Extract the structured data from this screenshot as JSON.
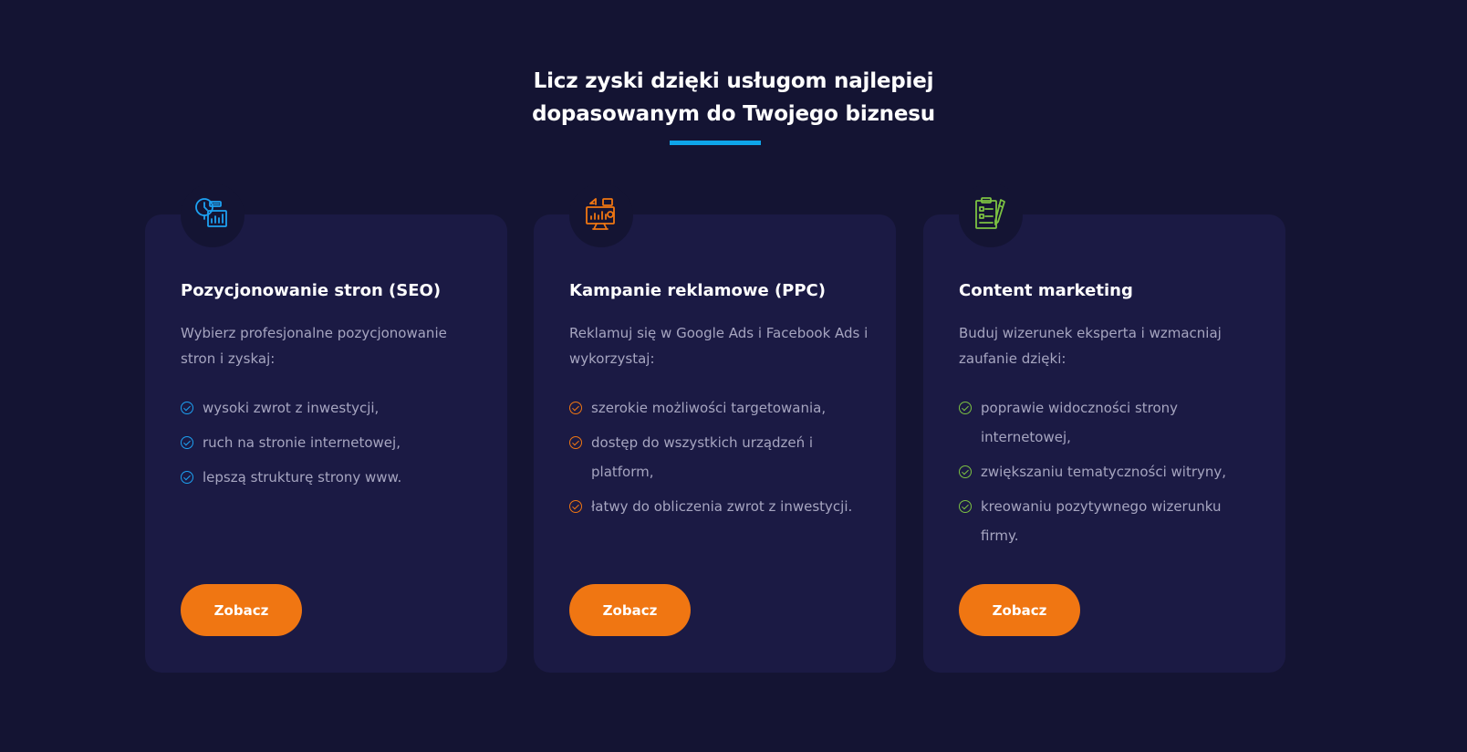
{
  "header": {
    "title_line1": "Licz zyski dzięki usługom najlepiej",
    "title_line2": "dopasowanym do Twojego biznesu",
    "accent_color": "#0ea5e9"
  },
  "cards": [
    {
      "icon": "seo-analytics-icon",
      "icon_color": "#1da1f2",
      "title": "Pozycjonowanie stron (SEO)",
      "description": "Wybierz profesjonalne pozycjonowanie stron i zyskaj:",
      "check_color": "#1da1f2",
      "items": [
        "wysoki zwrot z inwestycji,",
        "ruch na stronie internetowej,",
        "lepszą strukturę strony www."
      ],
      "button_label": "Zobacz"
    },
    {
      "icon": "ppc-campaign-icon",
      "icon_color": "#f07612",
      "title": "Kampanie reklamowe (PPC)",
      "description": "Reklamuj się w Google Ads i Facebook Ads i wykorzystaj:",
      "check_color": "#f07612",
      "items": [
        "szerokie możliwości targetowania,",
        "dostęp do wszystkich urządzeń i platform,",
        "łatwy do obliczenia zwrot z inwestycji."
      ],
      "button_label": "Zobacz"
    },
    {
      "icon": "content-marketing-icon",
      "icon_color": "#7cc242",
      "title": "Content marketing",
      "description": "Buduj wizerunek eksperta i wzmacniaj zaufanie dzięki:",
      "check_color": "#7cc242",
      "items": [
        "poprawie widoczności strony internetowej,",
        "zwiększaniu tematyczności witryny,",
        "kreowaniu pozytywnego wizerunku firmy."
      ],
      "button_label": "Zobacz"
    }
  ],
  "colors": {
    "background": "#141433",
    "card_background": "#1b1a44",
    "button": "#f07612",
    "text_muted": "#a6a5c0"
  }
}
